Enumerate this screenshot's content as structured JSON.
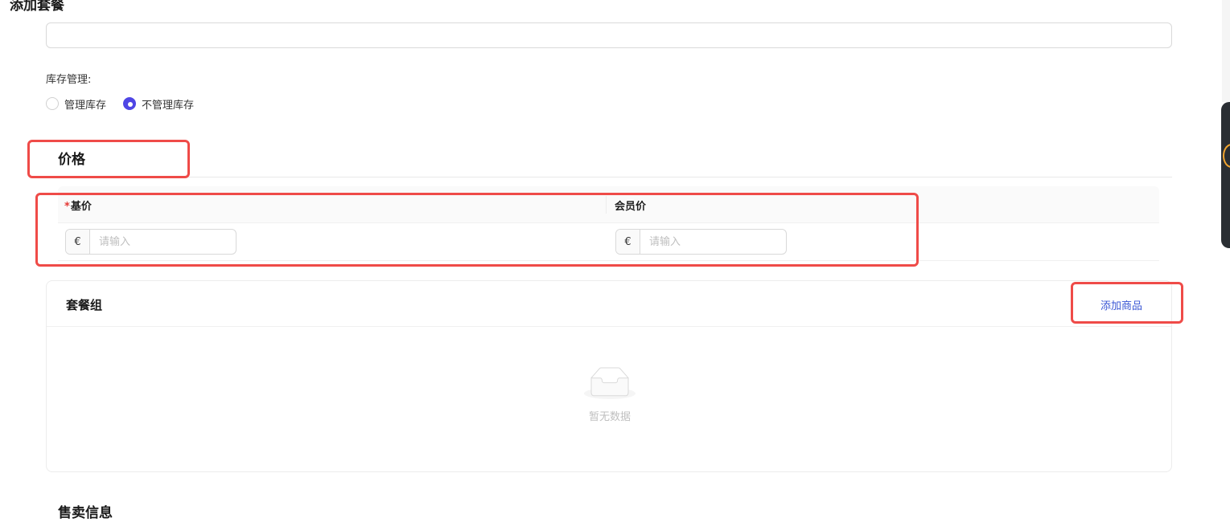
{
  "page": {
    "title": "添加套餐"
  },
  "stock": {
    "label": "库存管理:",
    "options": [
      {
        "label": "管理库存",
        "checked": false
      },
      {
        "label": "不管理库存",
        "checked": true
      }
    ]
  },
  "price": {
    "section_title": "价格",
    "columns": [
      {
        "required_mark": "*",
        "label": "基价"
      },
      {
        "label": "会员价"
      }
    ],
    "base_price": {
      "prefix": "€",
      "placeholder": "请输入",
      "value": ""
    },
    "member_price": {
      "prefix": "€",
      "placeholder": "请输入",
      "value": ""
    }
  },
  "package_group": {
    "title": "套餐组",
    "add_label": "添加商品",
    "empty_text": "暂无数据"
  },
  "sales": {
    "section_title": "售卖信息"
  },
  "colors": {
    "accent": "#4f46e5",
    "link": "#3b57d4",
    "highlight": "#ef4b48",
    "required": "#e53935"
  }
}
